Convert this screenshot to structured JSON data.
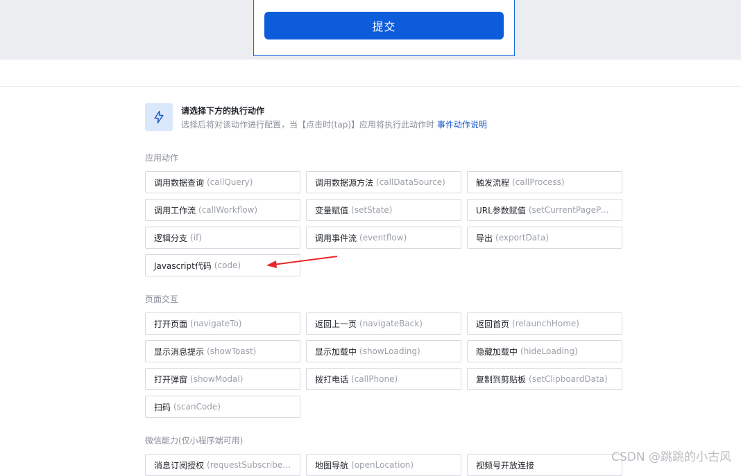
{
  "submit_label": "提交",
  "intro": {
    "icon": "lightning-icon",
    "title": "请选择下方的执行动作",
    "desc": "选择后将对该动作进行配置，当【点击时(tap)】应用将执行此动作时 ",
    "link": "事件动作说明"
  },
  "sections": [
    {
      "title": "应用动作",
      "items": [
        {
          "label": "调用数据查询",
          "code": "(callQuery)"
        },
        {
          "label": "调用数据源方法",
          "code": "(callDataSource)"
        },
        {
          "label": "触发流程",
          "code": "(callProcess)"
        },
        {
          "label": "调用工作流",
          "code": "(callWorkflow)"
        },
        {
          "label": "变量赋值",
          "code": "(setState)"
        },
        {
          "label": "URL参数赋值",
          "code": "(setCurrentPagePar..."
        },
        {
          "label": "逻辑分支",
          "code": "(if)"
        },
        {
          "label": "调用事件流",
          "code": "(eventflow)"
        },
        {
          "label": "导出",
          "code": "(exportData)"
        },
        {
          "label": "Javascript代码",
          "code": "(code)"
        }
      ]
    },
    {
      "title": "页面交互",
      "items": [
        {
          "label": "打开页面",
          "code": "(navigateTo)"
        },
        {
          "label": "返回上一页",
          "code": "(navigateBack)"
        },
        {
          "label": "返回首页",
          "code": "(relaunchHome)"
        },
        {
          "label": "显示消息提示",
          "code": "(showToast)"
        },
        {
          "label": "显示加载中",
          "code": "(showLoading)"
        },
        {
          "label": "隐藏加载中",
          "code": "(hideLoading)"
        },
        {
          "label": "打开弹窗",
          "code": "(showModal)"
        },
        {
          "label": "拨打电话",
          "code": "(callPhone)"
        },
        {
          "label": "复制到剪贴板",
          "code": "(setClipboardData)"
        },
        {
          "label": "扫码",
          "code": "(scanCode)"
        }
      ]
    },
    {
      "title": "微信能力(仅小程序端可用)",
      "items": [
        {
          "label": "消息订阅授权",
          "code": "(requestSubscribeM..."
        },
        {
          "label": "地图导航",
          "code": "(openLocation)"
        },
        {
          "label": "视频号开放连接",
          "code": ""
        }
      ]
    }
  ],
  "watermark": "CSDN @跳跳的小古风",
  "colors": {
    "primary": "#0d5cdc",
    "link": "#1859c9",
    "arrow": "#e8252a"
  }
}
